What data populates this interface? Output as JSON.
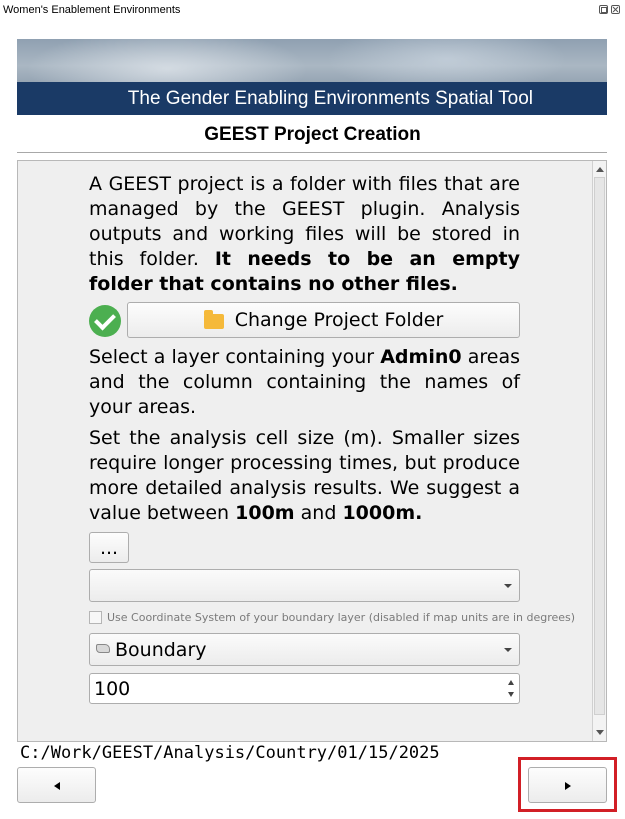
{
  "window": {
    "title": "Women's Enablement Environments"
  },
  "banner": {
    "text": "The Gender Enabling Environments Spatial Tool"
  },
  "page": {
    "title": "GEEST Project Creation"
  },
  "intro": {
    "text": "A GEEST project is a folder with files that are managed by the GEEST plugin. Analysis outputs and working files will be stored in this folder. ",
    "bold": "It needs to be an empty folder that contains no other files."
  },
  "change_folder": {
    "label": "Change Project Folder",
    "status_icon": "check-circle-icon",
    "icon": "folder-icon",
    "status_color": "#4caf50"
  },
  "layer_para": {
    "before": "Select a layer containing your ",
    "bold": "Admin0",
    "after": " areas and the column containing the names of your areas."
  },
  "cell_para": {
    "text": "Set the analysis cell size (m). Smaller sizes require longer processing times, but produce more detailed analysis results. We suggest a value between ",
    "bold1": "100m",
    "mid": " and ",
    "bold2": "1000m."
  },
  "browse_button": {
    "label": "..."
  },
  "layer_combo": {
    "value": ""
  },
  "crs_checkbox": {
    "label": "Use Coordinate System of your boundary layer (disabled if map units are in degrees)",
    "checked": false,
    "enabled": false
  },
  "boundary_combo": {
    "value": "Boundary",
    "icon": "polygon-layer-icon"
  },
  "cell_size": {
    "value": "100"
  },
  "path": {
    "text": "C:/Work/GEEST/Analysis/Country/01/15/2025"
  },
  "nav": {
    "prev_icon": "left-arrow-icon",
    "next_icon": "right-arrow-icon",
    "highlight_color": "#d21f26"
  }
}
